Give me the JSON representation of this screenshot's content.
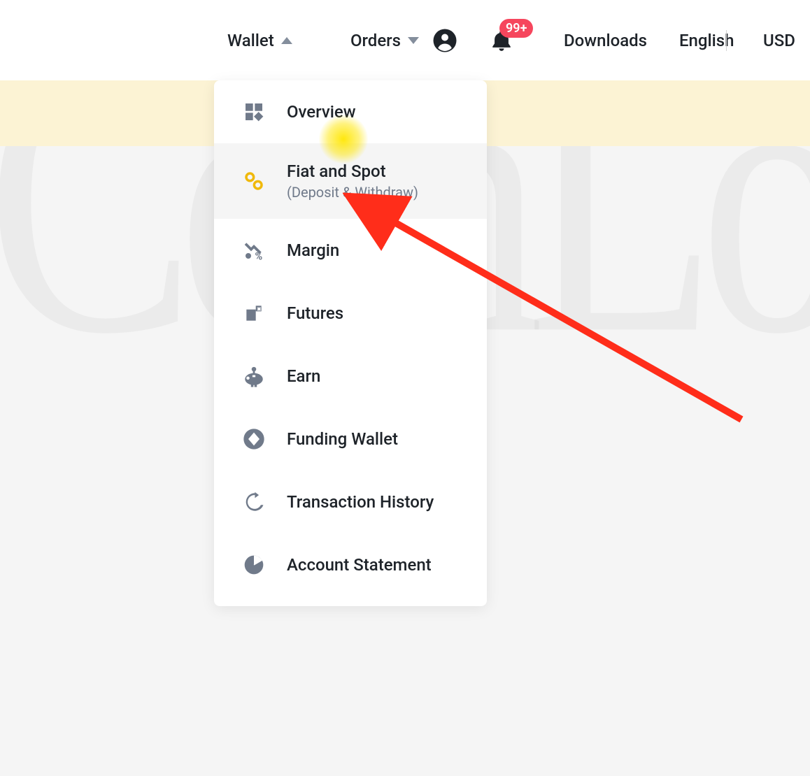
{
  "nav": {
    "wallet": "Wallet",
    "orders": "Orders",
    "downloads": "Downloads",
    "language": "English",
    "currency": "USD",
    "notification_badge": "99+"
  },
  "wallet_menu": {
    "items": [
      {
        "label": "Overview"
      },
      {
        "label": "Fiat and Spot",
        "sub": "(Deposit & Withdraw)"
      },
      {
        "label": "Margin"
      },
      {
        "label": "Futures"
      },
      {
        "label": "Earn"
      },
      {
        "label": "Funding Wallet"
      },
      {
        "label": "Transaction History"
      },
      {
        "label": "Account Statement"
      }
    ]
  },
  "watermark": "CoinLore",
  "annotation": {
    "arrow_color": "#ff2d1a",
    "highlight_target": "fiat-and-spot"
  }
}
